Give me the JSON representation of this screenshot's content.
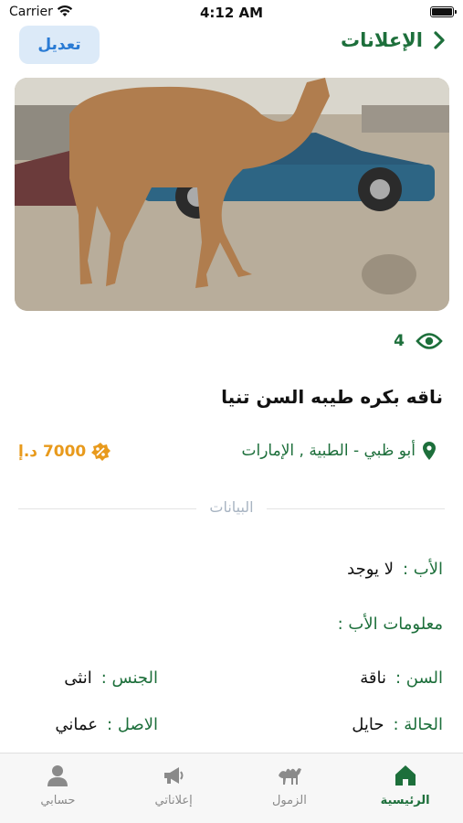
{
  "status_bar": {
    "carrier": "Carrier",
    "time": "4:12 AM"
  },
  "header": {
    "back_label": "الإعلانات",
    "edit_label": "تعديل"
  },
  "ad": {
    "views": "4",
    "title": "ناقه بكره طيبه السن تنيا",
    "location": "أبو ظبي - الطبية , الإمارات",
    "price": "7000 د.إ"
  },
  "details": {
    "section_title": "البيانات",
    "father_label": "الأب :",
    "father_value": "لا يوجد",
    "father_info_label": "معلومات الأب :",
    "age_label": "السن :",
    "age_value": "ناقة",
    "gender_label": "الجنس :",
    "gender_value": "انثى",
    "condition_label": "الحالة :",
    "condition_value": "حايل",
    "origin_label": "الاصل :",
    "origin_value": "عماني"
  },
  "tabs": [
    {
      "label": "الرئيسية",
      "icon": "home-icon",
      "active": true
    },
    {
      "label": "الزمول",
      "icon": "camel-icon",
      "active": false
    },
    {
      "label": "إعلاناتي",
      "icon": "megaphone-icon",
      "active": false
    },
    {
      "label": "حسابي",
      "icon": "person-icon",
      "active": false
    }
  ],
  "colors": {
    "accent": "#1d6f3b",
    "price": "#e89a1c",
    "edit_bg": "#dceaf8",
    "edit_text": "#2a7bd4"
  }
}
